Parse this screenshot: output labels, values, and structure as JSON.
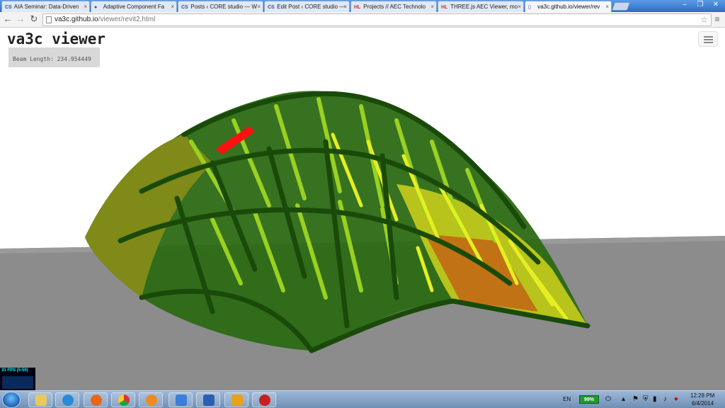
{
  "browser": {
    "tabs": [
      {
        "icon": "CS",
        "label": "AIA Seminar: Data-Driven"
      },
      {
        "icon": "github-icon",
        "label": "Adaptive Component Fa"
      },
      {
        "icon": "CS",
        "label": "Posts ‹ CORE studio — W"
      },
      {
        "icon": "CS",
        "label": "Edit Post ‹ CORE studio —"
      },
      {
        "icon": "HL",
        "label": "Projects // AEC Technolo"
      },
      {
        "icon": "HL",
        "label": "THREE.js AEC Viewer, mo"
      },
      {
        "icon": "page-icon",
        "label": "va3c.github.io/viewer/rev"
      }
    ],
    "url_host": "va3c.github.io",
    "url_path": "/viewer/revit2.html"
  },
  "viewer": {
    "title": "va3c viewer",
    "info": "Beam Length: 234.954449",
    "fps": "31 FPS (5-50)"
  },
  "taskbar": {
    "language": "EN",
    "battery": "99%",
    "time": "12:28 PM",
    "date": "6/4/2014"
  },
  "colors": {
    "truss_dark": "#1f5a10",
    "truss_mid": "#3a8a18",
    "truss_light": "#8ec420",
    "truss_yellow": "#e8f020",
    "truss_olive": "#7a8a18",
    "highlight_red": "#ff1010",
    "ground": "#8a8a8a"
  }
}
